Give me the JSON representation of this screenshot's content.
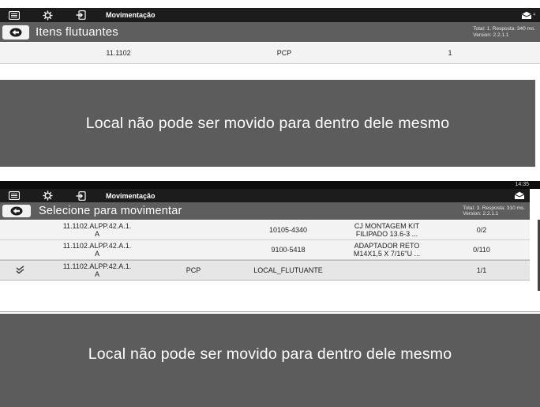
{
  "screen1": {
    "topbar": {
      "title": "Movimentação",
      "right_badge": "4"
    },
    "header": {
      "title": "Itens flutuantes",
      "meta_line1": "Total: 1. Resposta: 340 ms.",
      "meta_line2": "Version: 2.2.1.1"
    },
    "rows": [
      {
        "location": "11.1102",
        "store": "PCP",
        "qty": "1"
      }
    ]
  },
  "toast1": {
    "text": "Local não pode ser movido para dentro dele mesmo"
  },
  "screen2": {
    "status_time": "14:35",
    "topbar": {
      "title": "Movimentação"
    },
    "header": {
      "title": "Selecione para movimentar",
      "meta_line1": "Total: 3. Resposta: 310 ms.",
      "meta_line2": "Version: 2.2.1.1"
    },
    "rows": [
      {
        "loc_line1": "11.1102.ALPP.42.A.1.",
        "loc_line2": "A",
        "store": "",
        "code": "10105-4340",
        "desc_line1": "CJ MONTAGEM KIT",
        "desc_line2": "FILIPADO 13.6-3 ...",
        "qty": "0/2"
      },
      {
        "loc_line1": "11.1102.ALPP.42.A.1.",
        "loc_line2": "A",
        "store": "",
        "code": "9100-5418",
        "desc_line1": "ADAPTADOR RETO",
        "desc_line2": "M14X1,5 X 7/16\"U ...",
        "qty": "0/110"
      },
      {
        "loc_line1": "11.1102.ALPP.42.A.1.",
        "loc_line2": "A",
        "store": "PCP",
        "code": "LOCAL_FLUTUANTE",
        "desc_line1": "",
        "desc_line2": "",
        "qty": "1/1"
      }
    ]
  },
  "toast2": {
    "text": "Local não pode ser movido para dentro dele mesmo"
  },
  "colors": {
    "topbar": "#1c1c1c",
    "header": "#5e5e5e",
    "toast": "#5c5c5c",
    "row": "#f3f3f3"
  }
}
